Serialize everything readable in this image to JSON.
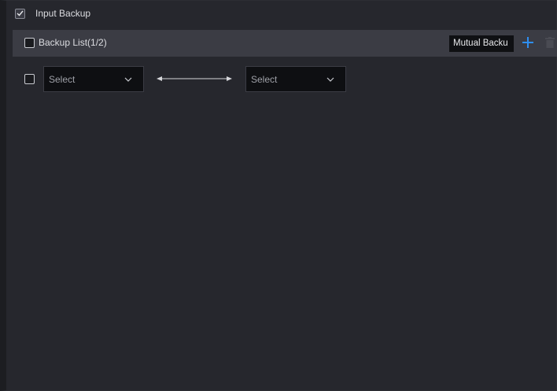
{
  "header": {
    "checkbox_checked": true,
    "label": "Input Backup"
  },
  "list": {
    "title": "Backup List(1/2)",
    "mutual_button": "Mutual Backu",
    "add_icon": "plus-icon",
    "delete_icon": "trash-icon"
  },
  "rows": [
    {
      "source_select": "Select",
      "target_select": "Select"
    }
  ],
  "colors": {
    "accent": "#2e8ff2",
    "background": "#26272d",
    "bar": "#3b3c44"
  }
}
